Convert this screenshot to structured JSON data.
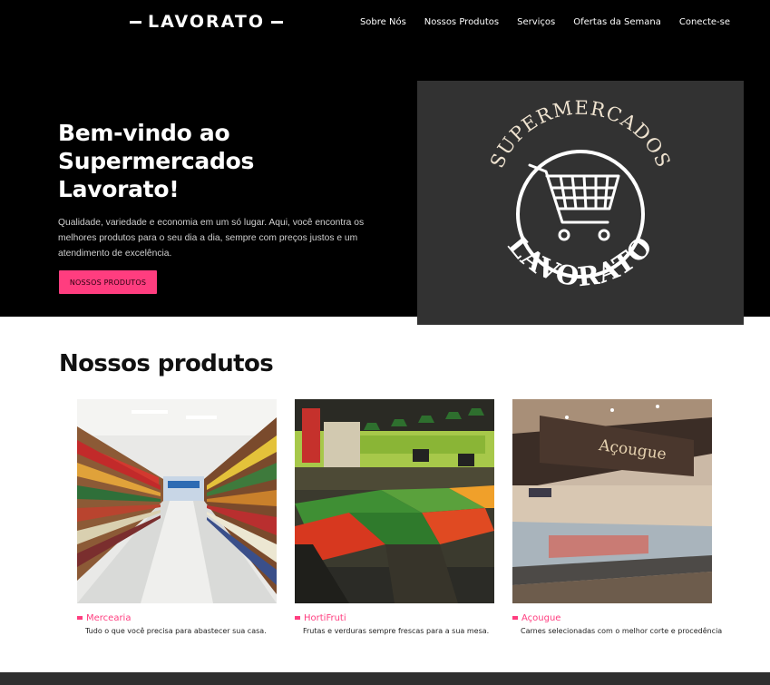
{
  "brand": {
    "name": "LAVORATO"
  },
  "nav": {
    "items": [
      "Sobre Nós",
      "Nossos Produtos",
      "Serviços",
      "Ofertas da Semana",
      "Conecte-se"
    ]
  },
  "hero": {
    "title": "Bem-vindo ao Supermercados Lavorato!",
    "text": "Qualidade, variedade e economia em um só lugar. Aqui, você encontra os melhores produtos para o seu dia a dia, sempre com preços justos e um atendimento de excelência.",
    "button_label": "NOSSOS PRODUTOS",
    "logo_top_text": "SUPERMERCADOS",
    "logo_bottom_text": "LAVORATO"
  },
  "products": {
    "title": "Nossos produtos",
    "items": [
      {
        "label": "Mercearia",
        "description": "Tudo o que você precisa para abastecer sua casa."
      },
      {
        "label": "HortiFruti",
        "description": "Frutas e verduras sempre frescas para a sua mesa."
      },
      {
        "label": "Açougue",
        "description": "Carnes selecionadas com o melhor corte e procedência"
      }
    ]
  },
  "photo_sign": {
    "text": "Açougue"
  },
  "colors": {
    "accent": "#ff3d7f",
    "hero_bg": "#000000",
    "card_bg": "#323232",
    "logo_ink": "#efe3d0"
  }
}
